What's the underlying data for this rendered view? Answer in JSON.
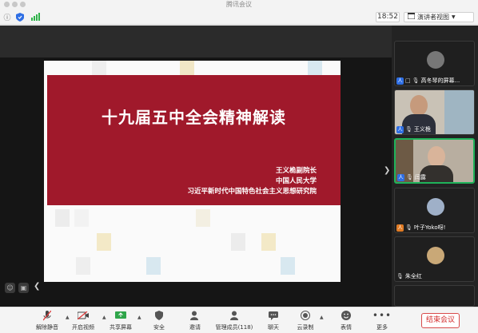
{
  "window": {
    "title": "腾讯会议"
  },
  "toolbar": {
    "timer": "18:52",
    "view_label": "演讲者视图"
  },
  "slide": {
    "title": "十九届五中全会精神解读",
    "subtitle_lines": [
      "王义桅副院长",
      "中国人民大学",
      "习近平新时代中国特色社会主义思想研究院"
    ]
  },
  "participants": [
    {
      "name": "高冬琴的屏幕...",
      "tag": "人"
    },
    {
      "name": "王义桅",
      "tag": "人"
    },
    {
      "name": "闫露",
      "tag": "人"
    },
    {
      "name": "叶子Yoko呀!",
      "tag": "人"
    },
    {
      "name": "朱全红",
      "tag": ""
    }
  ],
  "bottom_bar": {
    "buttons": [
      {
        "label": "解除静音",
        "icon": "mic-off-icon"
      },
      {
        "label": "开启视频",
        "icon": "video-off-icon"
      },
      {
        "label": "共享屏幕",
        "icon": "share-screen-icon"
      },
      {
        "label": "安全",
        "icon": "shield-icon"
      },
      {
        "label": "邀请",
        "icon": "invite-icon"
      },
      {
        "label": "管理成员(118)",
        "icon": "members-icon"
      },
      {
        "label": "聊天",
        "icon": "chat-icon"
      },
      {
        "label": "云录制",
        "icon": "cloud-record-icon"
      },
      {
        "label": "表情",
        "icon": "emoji-icon"
      },
      {
        "label": "更多",
        "icon": "more-icon"
      }
    ],
    "end_label": "结束会议"
  },
  "colors": {
    "banner": "#a0192b",
    "active_border": "#1fb35a",
    "end_red": "#d32f2f"
  }
}
